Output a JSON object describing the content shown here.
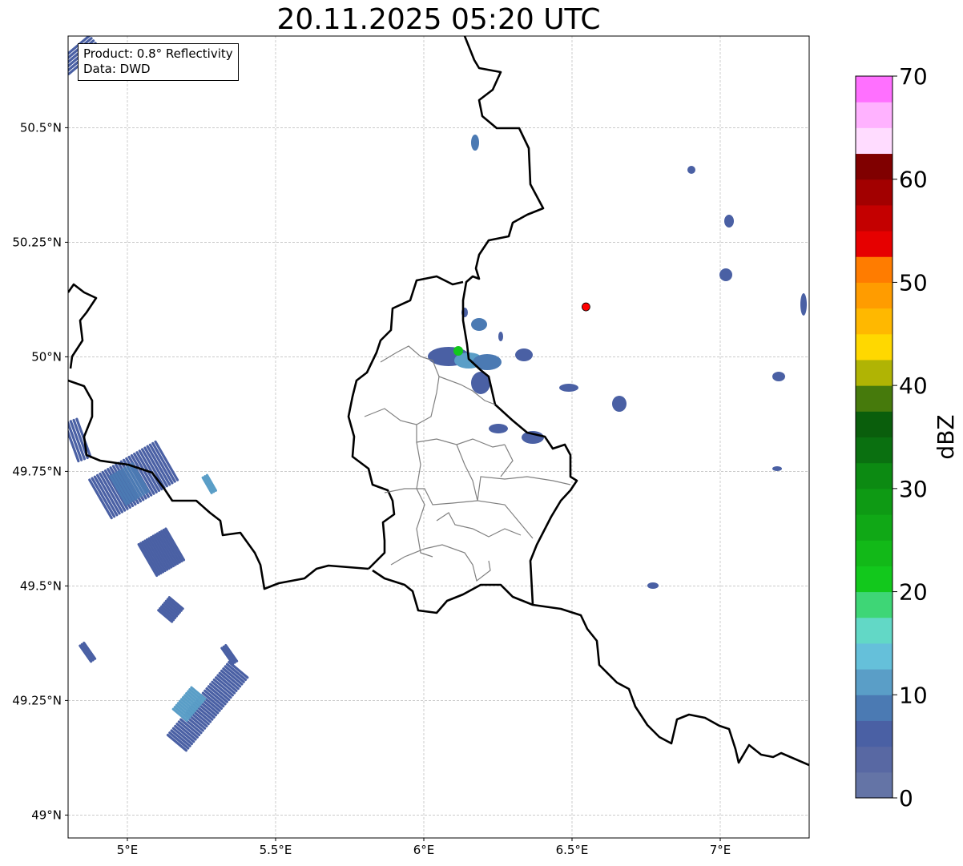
{
  "title": "20.11.2025 05:20 UTC",
  "infobox": {
    "product": "Product: 0.8° Reflectivity",
    "data": "Data: DWD"
  },
  "axes": {
    "lon_range": [
      4.8,
      7.3
    ],
    "lat_range": [
      48.95,
      50.7
    ],
    "lon_ticks": [
      {
        "value": 5.0,
        "label": "5°E"
      },
      {
        "value": 5.5,
        "label": "5.5°E"
      },
      {
        "value": 6.0,
        "label": "6°E"
      },
      {
        "value": 6.5,
        "label": "6.5°E"
      },
      {
        "value": 7.0,
        "label": "7°E"
      }
    ],
    "lat_ticks": [
      {
        "value": 50.5,
        "label": "50.5°N"
      },
      {
        "value": 50.25,
        "label": "50.25°N"
      },
      {
        "value": 50.0,
        "label": "50°N"
      },
      {
        "value": 49.75,
        "label": "49.75°N"
      },
      {
        "value": 49.5,
        "label": "49.5°N"
      },
      {
        "value": 49.25,
        "label": "49.25°N"
      },
      {
        "value": 49.0,
        "label": "49°N"
      }
    ],
    "grid": true
  },
  "marker": {
    "lon": 6.547,
    "lat": 50.109,
    "color": "#ff0000"
  },
  "colorbar": {
    "label": "dBZ",
    "range": [
      0,
      70
    ],
    "step": 2.5,
    "tick_labels": [
      "0",
      "10",
      "20",
      "30",
      "40",
      "50",
      "60",
      "70"
    ],
    "colors": [
      "#6474a6",
      "#5868a3",
      "#4a60a4",
      "#4b7ab3",
      "#5a9ec7",
      "#65c0da",
      "#62d8c6",
      "#3ed676",
      "#12c81c",
      "#12b918",
      "#10a816",
      "#0e9a14",
      "#0c8a12",
      "#0a7010",
      "#0a5e0c",
      "#467a0c",
      "#b0b404",
      "#ffd800",
      "#ffb800",
      "#ff9c00",
      "#ff7c00",
      "#e60000",
      "#c40000",
      "#a20000",
      "#800000",
      "#ffdcff",
      "#ffb2ff",
      "#ff70ff",
      "#ec34ec"
    ]
  }
}
